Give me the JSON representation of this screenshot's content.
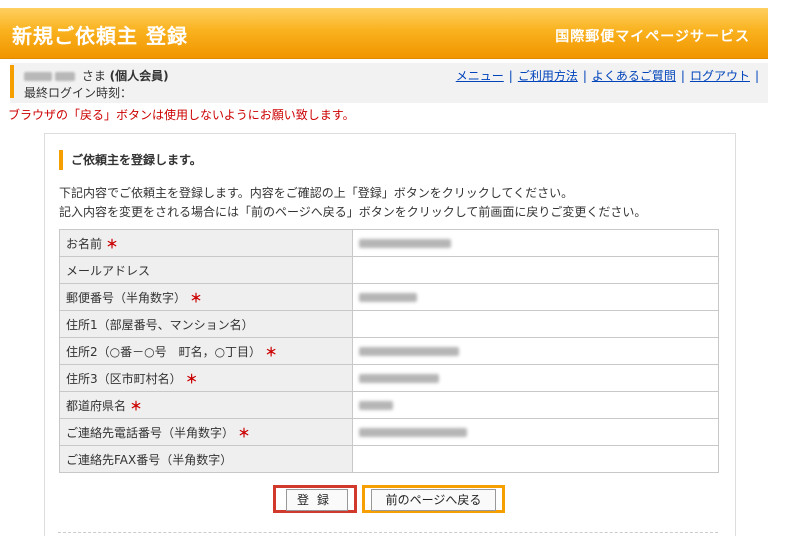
{
  "header": {
    "title": "新規ご依頼主 登録",
    "service": "国際郵便マイページサービス"
  },
  "user": {
    "suffix": "さま",
    "member_type": "(個人会員)",
    "last_login_label": "最終ログイン時刻："
  },
  "nav_links": [
    {
      "label": "メニュー"
    },
    {
      "label": "ご利用方法"
    },
    {
      "label": "よくあるご質問"
    },
    {
      "label": "ログアウト"
    }
  ],
  "warning": "ブラウザの「戻る」ボタンは使用しないようにお願い致します。",
  "section": {
    "heading": "ご依頼主を登録します。",
    "desc1": "下記内容でご依頼主を登録します。内容をご確認の上「登録」ボタンをクリックしてください。",
    "desc2": "記入内容を変更をされる場合には「前のページへ戻る」ボタンをクリックして前画面に戻りご変更ください。"
  },
  "form_rows": [
    {
      "label": "お名前",
      "required": true
    },
    {
      "label": "メールアドレス",
      "required": false
    },
    {
      "label": "郵便番号（半角数字）",
      "required": true
    },
    {
      "label": "住所1（部屋番号、マンション名）",
      "required": false
    },
    {
      "label": "住所2（○番－○号　町名，○丁目）",
      "required": true
    },
    {
      "label": "住所3（区市町村名）",
      "required": true
    },
    {
      "label": "都道府県名",
      "required": true
    },
    {
      "label": "ご連絡先電話番号（半角数字）",
      "required": true
    },
    {
      "label": "ご連絡先FAX番号（半角数字）",
      "required": false
    }
  ],
  "required_mark": "＊",
  "buttons": {
    "register": "登録",
    "back": "前のページへ戻る"
  }
}
